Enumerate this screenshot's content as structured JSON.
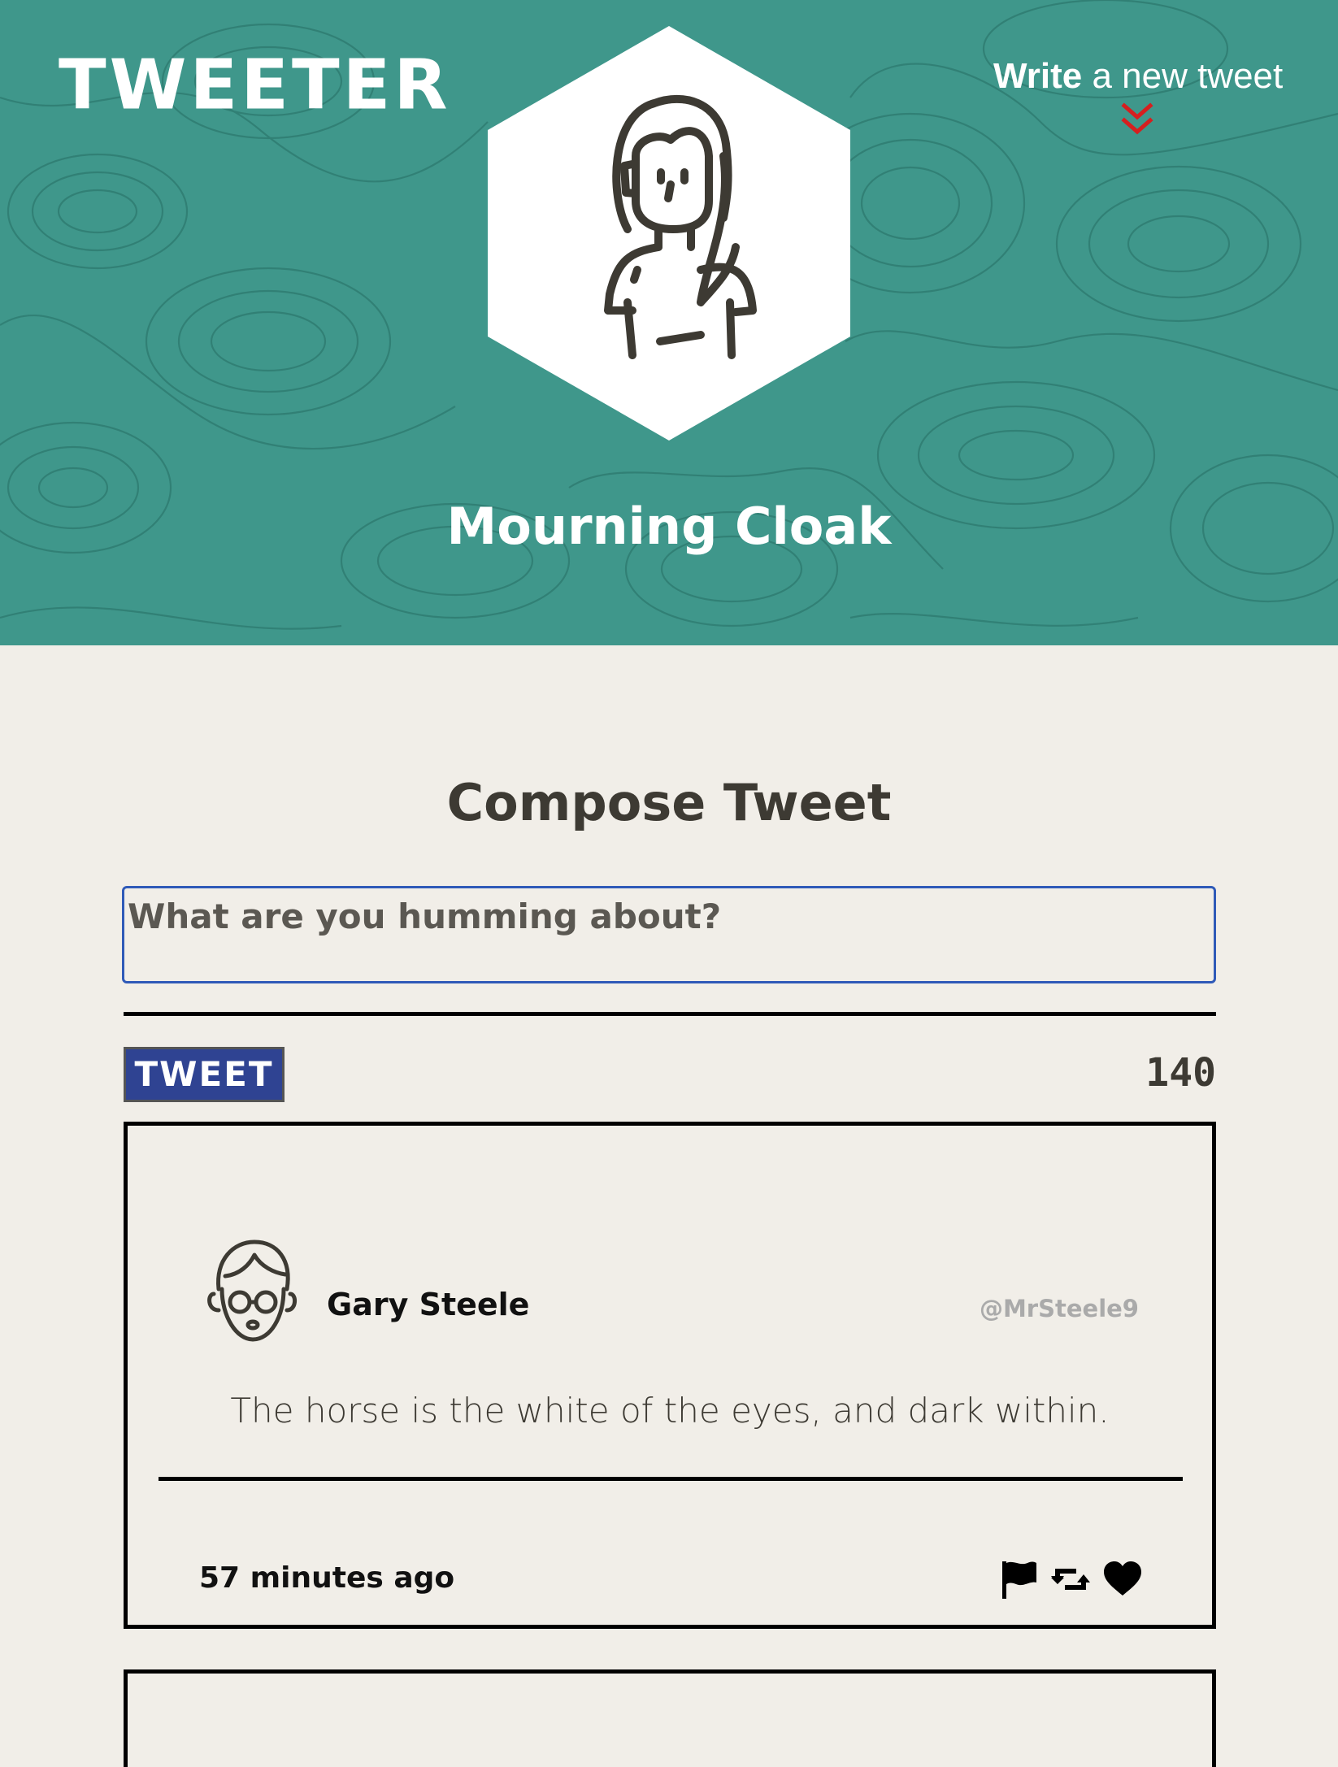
{
  "nav": {
    "brand": "TWEETER",
    "write_strong": "Write",
    "write_rest": " a new tweet",
    "chevron_icon": "double-chevron-down-icon"
  },
  "profile": {
    "name": "Mourning Cloak",
    "avatar_icon": "woman-avatar-icon"
  },
  "compose": {
    "title": "Compose Tweet",
    "placeholder": "What are you humming about?",
    "value": "",
    "button_label": "TWEET",
    "counter": "140"
  },
  "tweets": [
    {
      "avatar_icon": "man-with-glasses-avatar-icon",
      "name": "Gary Steele",
      "handle": "@MrSteele9",
      "text": "The horse is the white of the eyes, and dark within.",
      "time": "57 minutes ago",
      "actions": [
        "flag-icon",
        "retweet-icon",
        "heart-icon"
      ]
    }
  ],
  "colors": {
    "header_bg": "#3f978b",
    "page_bg": "#f1eee8",
    "button_bg": "#2f4392",
    "input_border": "#2f5ab8",
    "chevron": "#d61f1f",
    "text": "#3d3a33",
    "handle": "#aaaaaa"
  }
}
